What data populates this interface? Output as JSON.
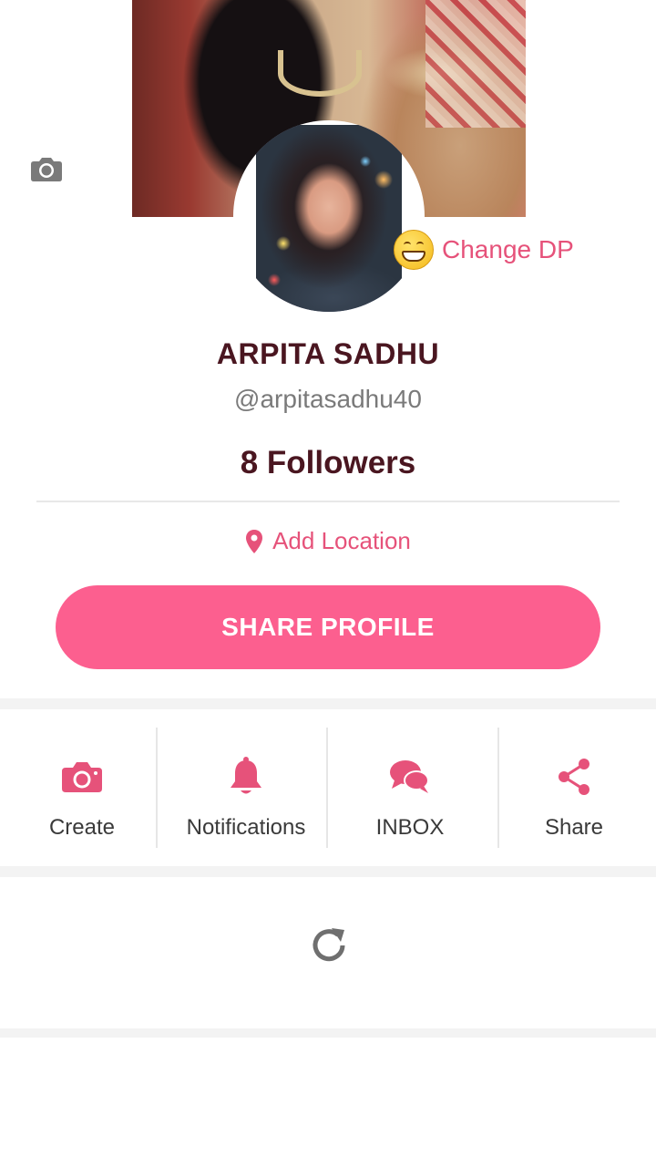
{
  "profile": {
    "name": "ARPITA SADHU",
    "handle": "@arpitasadhu40",
    "followers": "8 Followers",
    "change_dp_label": "Change DP",
    "add_location_label": "Add Location",
    "share_profile_label": "SHARE PROFILE"
  },
  "actions": [
    {
      "label": "Create",
      "icon": "camera-icon"
    },
    {
      "label": "Notifications",
      "icon": "bell-icon"
    },
    {
      "label": "INBOX",
      "icon": "chat-bubbles-icon"
    },
    {
      "label": "Share",
      "icon": "share-icon"
    }
  ],
  "colors": {
    "accent": "#fc5f8f",
    "accent_text": "#e6527a",
    "name_text": "#4a1620"
  }
}
